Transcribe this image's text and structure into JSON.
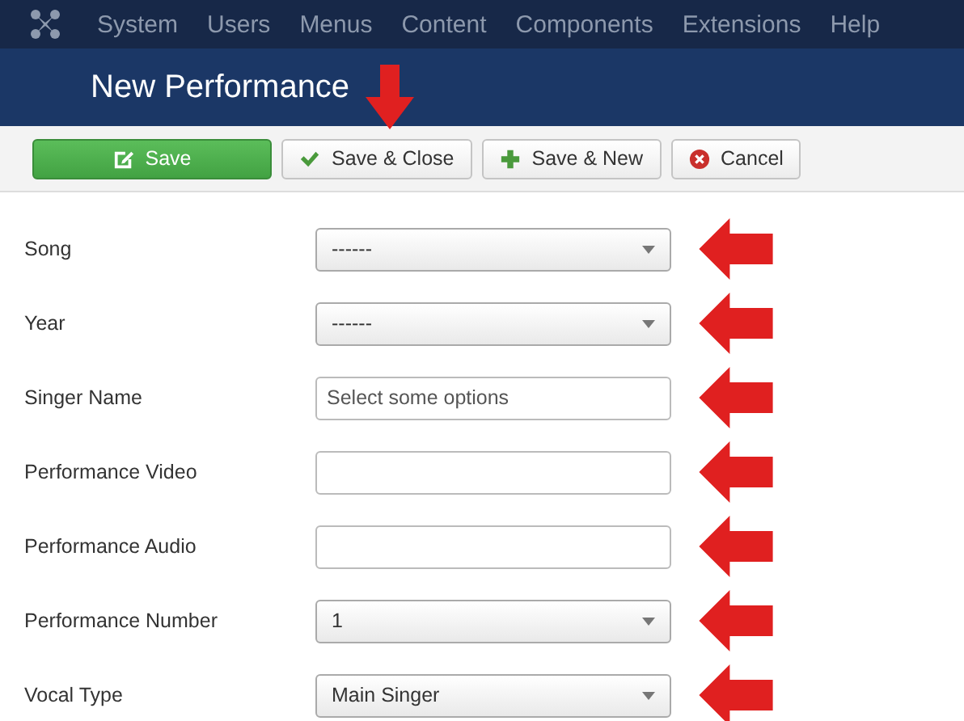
{
  "menu": {
    "items": [
      "System",
      "Users",
      "Menus",
      "Content",
      "Components",
      "Extensions",
      "Help"
    ]
  },
  "header": {
    "title": "New Performance"
  },
  "toolbar": {
    "buttons": [
      {
        "label": "Save",
        "kind": "save"
      },
      {
        "label": "Save & Close",
        "kind": "save_close"
      },
      {
        "label": "Save & New",
        "kind": "save_new"
      },
      {
        "label": "Cancel",
        "kind": "cancel"
      }
    ]
  },
  "fields": [
    {
      "label": "Song",
      "kind": "select",
      "value": "------"
    },
    {
      "label": "Year",
      "kind": "select",
      "value": "------"
    },
    {
      "label": "Singer Name",
      "kind": "text",
      "placeholder": "Select some options"
    },
    {
      "label": "Performance Video",
      "kind": "text"
    },
    {
      "label": "Performance Audio",
      "kind": "text"
    },
    {
      "label": "Performance Number",
      "kind": "select",
      "value": "1"
    },
    {
      "label": "Vocal Type",
      "kind": "select",
      "value": "Main Singer"
    }
  ]
}
